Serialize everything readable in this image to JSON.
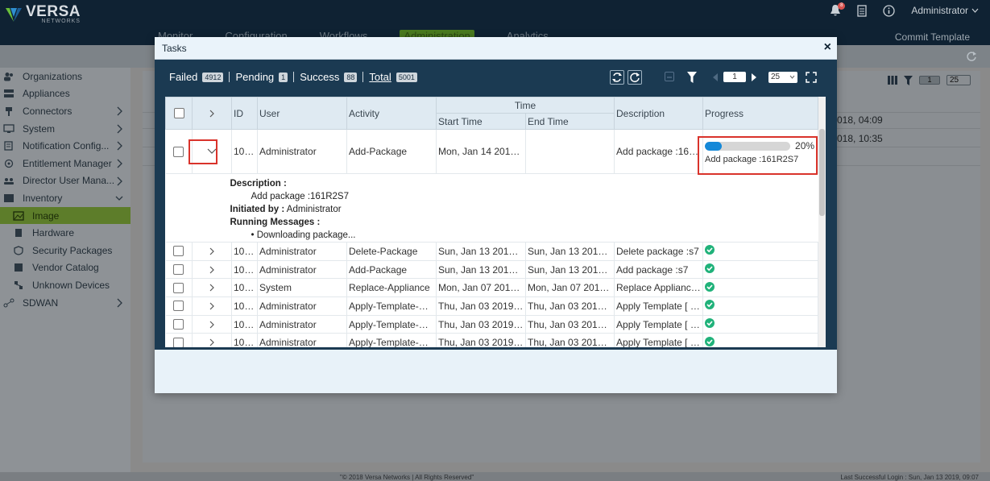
{
  "app": {
    "brand": "VERSA",
    "brand_sub": "NETWORKS",
    "user": "Administrator",
    "notification_count": "8",
    "nav_tabs": [
      "Monitor",
      "Configuration",
      "Workflows",
      "Administration",
      "Analytics"
    ],
    "commit_template": "Commit Template"
  },
  "sidebar": {
    "items": [
      {
        "label": "Organizations",
        "icon": "organizations-icon"
      },
      {
        "label": "Appliances",
        "icon": "appliances-icon"
      },
      {
        "label": "Connectors",
        "icon": "connectors-icon"
      },
      {
        "label": "System",
        "icon": "system-icon"
      },
      {
        "label": "Notification Config...",
        "icon": "notification-config-icon"
      },
      {
        "label": "Entitlement Manager",
        "icon": "entitlement-icon"
      },
      {
        "label": "Director User Mana...",
        "icon": "director-users-icon"
      },
      {
        "label": "Inventory",
        "icon": "inventory-icon"
      },
      {
        "label": "Image",
        "icon": "image-icon"
      },
      {
        "label": "Hardware",
        "icon": "hardware-icon"
      },
      {
        "label": "Security Packages",
        "icon": "security-packages-icon"
      },
      {
        "label": "Vendor Catalog",
        "icon": "vendor-catalog-icon"
      },
      {
        "label": "Unknown Devices",
        "icon": "unknown-devices-icon"
      },
      {
        "label": "SDWAN",
        "icon": "sdwan-icon"
      }
    ]
  },
  "background": {
    "page": "1",
    "page_size": "25",
    "dates": [
      "018, 04:09",
      "018, 10:35"
    ]
  },
  "modal": {
    "title": "Tasks",
    "close": "×",
    "stats": {
      "failed_label": "Failed",
      "failed_count": "4912",
      "pending_label": "Pending",
      "pending_count": "1",
      "success_label": "Success",
      "success_count": "88",
      "total_label": "Total",
      "total_count": "5001"
    },
    "toolbar": {
      "page": "1",
      "page_size": "25"
    },
    "columns": {
      "id": "ID",
      "user": "User",
      "activity": "Activity",
      "time": "Time",
      "start": "Start Time",
      "end": "End Time",
      "description": "Description",
      "progress": "Progress"
    },
    "expanded_row": {
      "id": "102...",
      "user": "Administrator",
      "activity": "Add-Package",
      "start": "Mon, Jan 14 2019, ...",
      "end": "",
      "description": "Add package :161R...",
      "progress_percent": 20,
      "progress_label": "20%",
      "progress_text": "Add package :161R2S7"
    },
    "detail": {
      "description_label": "Description :",
      "description_value": "Add package :161R2S7",
      "initiated_label": "Initiated by :",
      "initiated_value": "Administrator",
      "messages_label": "Running Messages :",
      "message": "Downloading package..."
    },
    "rows": [
      {
        "id": "102...",
        "user": "Administrator",
        "activity": "Delete-Package",
        "start": "Sun, Jan 13 2019, 0...",
        "end": "Sun, Jan 13 2019, 0...",
        "description": "Delete package :s7"
      },
      {
        "id": "102...",
        "user": "Administrator",
        "activity": "Add-Package",
        "start": "Sun, Jan 13 2019, 0...",
        "end": "Sun, Jan 13 2019, 0...",
        "description": "Add package :s7"
      },
      {
        "id": "102...",
        "user": "System",
        "activity": "Replace-Appliance",
        "start": "Mon, Jan 07 2019, ...",
        "end": "Mon, Jan 07 2019, ...",
        "description": "Replace Appliance:..."
      },
      {
        "id": "102...",
        "user": "Administrator",
        "activity": "Apply-Template-De...",
        "start": "Thu, Jan 03 2019, 0...",
        "end": "Thu, Jan 03 2019, 0...",
        "description": "Apply Template [ N..."
      },
      {
        "id": "102...",
        "user": "Administrator",
        "activity": "Apply-Template-De...",
        "start": "Thu, Jan 03 2019, 0...",
        "end": "Thu, Jan 03 2019, 0...",
        "description": "Apply Template [ N..."
      },
      {
        "id": "102...",
        "user": "Administrator",
        "activity": "Apply-Template-De...",
        "start": "Thu, Jan 03 2019, 0...",
        "end": "Thu, Jan 03 2019, 0...",
        "description": "Apply Template [ N..."
      }
    ]
  },
  "footer": {
    "copyright": "\"© 2018 Versa Networks | All Rights Reserved\"",
    "last_login": "Last Successful Login : Sun, Jan 13 2019, 09:07"
  },
  "colors": {
    "accent": "#1488d8",
    "success": "#20b27a",
    "highlight": "#d9332b"
  }
}
